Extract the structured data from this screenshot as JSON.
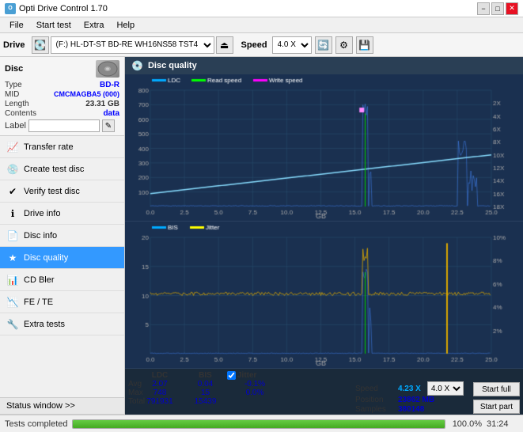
{
  "titlebar": {
    "title": "Opti Drive Control 1.70",
    "icon": "O",
    "controls": {
      "min": "−",
      "max": "□",
      "close": "✕"
    }
  },
  "menubar": {
    "items": [
      "File",
      "Start test",
      "Extra",
      "Help"
    ]
  },
  "toolbar": {
    "drive_label": "Drive",
    "drive_value": "(F:)  HL-DT-ST BD-RE  WH16NS58 TST4",
    "speed_label": "Speed",
    "speed_value": "4.0 X"
  },
  "disc": {
    "title": "Disc",
    "type_label": "Type",
    "type_value": "BD-R",
    "mid_label": "MID",
    "mid_value": "CMCMAGBA5 (000)",
    "length_label": "Length",
    "length_value": "23.31 GB",
    "contents_label": "Contents",
    "contents_value": "data",
    "label_label": "Label",
    "label_value": ""
  },
  "nav": {
    "items": [
      {
        "id": "transfer-rate",
        "label": "Transfer rate",
        "icon": "📈"
      },
      {
        "id": "create-test-disc",
        "label": "Create test disc",
        "icon": "💿"
      },
      {
        "id": "verify-test-disc",
        "label": "Verify test disc",
        "icon": "✔"
      },
      {
        "id": "drive-info",
        "label": "Drive info",
        "icon": "ℹ"
      },
      {
        "id": "disc-info",
        "label": "Disc info",
        "icon": "📄"
      },
      {
        "id": "disc-quality",
        "label": "Disc quality",
        "icon": "★",
        "active": true
      },
      {
        "id": "cd-bler",
        "label": "CD Bler",
        "icon": "📊"
      },
      {
        "id": "fe-te",
        "label": "FE / TE",
        "icon": "📉"
      },
      {
        "id": "extra-tests",
        "label": "Extra tests",
        "icon": "🔧"
      }
    ]
  },
  "content": {
    "title": "Disc quality",
    "legend": {
      "ldc": "LDC",
      "read_speed": "Read speed",
      "write_speed": "Write speed",
      "bis": "BIS",
      "jitter": "Jitter"
    }
  },
  "stats": {
    "headers": {
      "ldc": "LDC",
      "bis": "BIS",
      "jitter": "Jitter",
      "speed": "Speed",
      "position": "Position",
      "samples": "Samples"
    },
    "avg_label": "Avg",
    "max_label": "Max",
    "total_label": "Total",
    "avg_ldc": "2.07",
    "avg_bis": "0.04",
    "avg_jitter": "-0.1%",
    "max_ldc": "748",
    "max_bis": "15",
    "max_jitter": "0.0%",
    "total_ldc": "791931",
    "total_bis": "15439",
    "speed_value": "4.23 X",
    "speed_select": "4.0 X",
    "position_value": "23862 MB",
    "samples_value": "380148",
    "jitter_checked": true,
    "start_full": "Start full",
    "start_part": "Start part"
  },
  "statusbar": {
    "status": "Tests completed",
    "progress": 100,
    "progress_text": "100.0%",
    "time": "31:24"
  }
}
